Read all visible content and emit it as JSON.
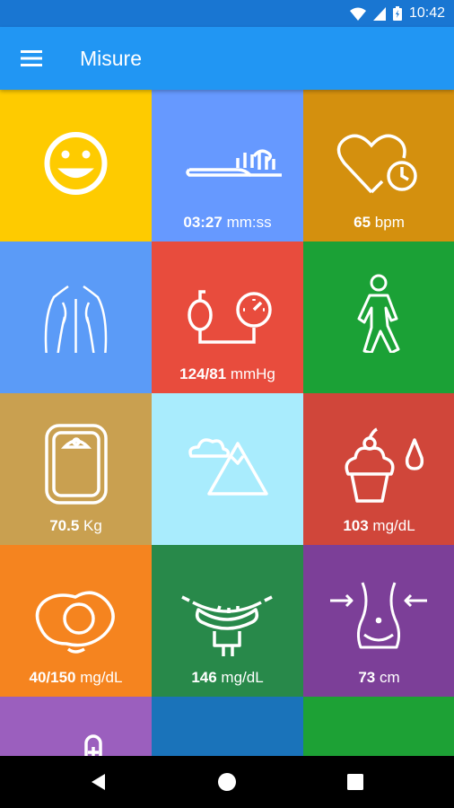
{
  "status_bar": {
    "time": "10:42"
  },
  "app_bar": {
    "title": "Misure",
    "menu_icon": "hamburger-icon"
  },
  "tiles": [
    {
      "name": "mood",
      "icon": "smiley-icon",
      "color": "#FECB00",
      "value": "",
      "unit": ""
    },
    {
      "name": "toothbrushing",
      "icon": "toothbrush-icon",
      "color": "#6699FF",
      "value": "03:27",
      "unit": " mm:ss"
    },
    {
      "name": "heart-rate",
      "icon": "heart-rate-icon",
      "color": "#D4900E",
      "value": "65",
      "unit": " bpm"
    },
    {
      "name": "back",
      "icon": "back-body-icon",
      "color": "#5B9BF7",
      "value": "",
      "unit": ""
    },
    {
      "name": "blood-pressure",
      "icon": "blood-pressure-icon",
      "color": "#E84C3D",
      "value": "124/81",
      "unit": " mmHg"
    },
    {
      "name": "walking",
      "icon": "walking-icon",
      "color": "#1BA136",
      "value": "",
      "unit": ""
    },
    {
      "name": "weight",
      "icon": "scale-icon",
      "color": "#C9A050",
      "value": "70.5",
      "unit": " Kg"
    },
    {
      "name": "altitude",
      "icon": "mountain-icon",
      "color": "#A9ECFD",
      "value": "",
      "unit": ""
    },
    {
      "name": "blood-sugar",
      "icon": "cupcake-drop-icon",
      "color": "#D0463A",
      "value": "103",
      "unit": " mg/dL"
    },
    {
      "name": "cholesterol",
      "icon": "egg-icon",
      "color": "#F5841F",
      "value": "40/150",
      "unit": " mg/dL"
    },
    {
      "name": "triglycerides",
      "icon": "sausage-icon",
      "color": "#28894A",
      "value": "146",
      "unit": " mg/dL"
    },
    {
      "name": "waist",
      "icon": "waist-icon",
      "color": "#7C3F98",
      "value": "73",
      "unit": " cm"
    },
    {
      "name": "thermometer",
      "icon": "thermometer-icon",
      "color": "#9B5FBE",
      "value": "",
      "unit": ""
    },
    {
      "name": "misc",
      "icon": "circle-icon",
      "color": "#1A73BA",
      "value": "",
      "unit": ""
    },
    {
      "name": "funnel",
      "icon": "funnel-icon",
      "color": "#1DA135",
      "value": "",
      "unit": ""
    }
  ],
  "nav_bar": {
    "back_icon": "back-triangle-icon",
    "home_icon": "home-circle-icon",
    "recents_icon": "recents-square-icon"
  }
}
